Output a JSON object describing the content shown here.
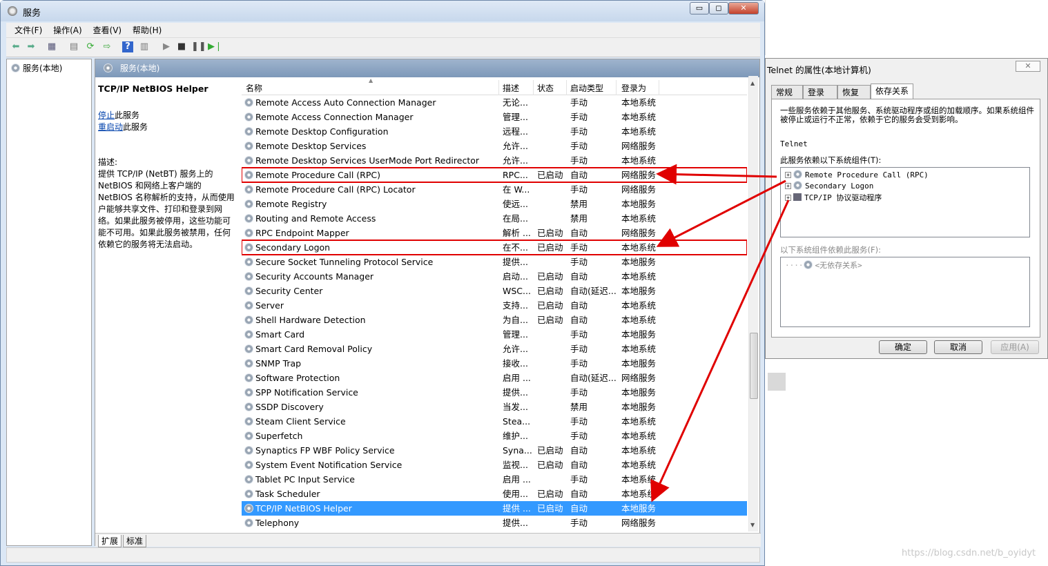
{
  "window": {
    "title": "服务",
    "buttons": {
      "minimize": "▭",
      "maximize": "◻",
      "close": "✕"
    }
  },
  "menu": [
    "文件(F)",
    "操作(A)",
    "查看(V)",
    "帮助(H)"
  ],
  "left_tree": {
    "root": "服务(本地)"
  },
  "panel_header": "服务(本地)",
  "detail": {
    "title": "TCP/IP NetBIOS Helper",
    "stop_link": "停止",
    "stop_suffix": "此服务",
    "restart_link": "重启动",
    "restart_suffix": "此服务",
    "desc_label": "描述:",
    "desc_text": "提供 TCP/IP (NetBT) 服务上的 NetBIOS 和网络上客户端的 NetBIOS 名称解析的支持，从而使用户能够共享文件、打印和登录到网络。如果此服务被停用，这些功能可能不可用。如果此服务被禁用，任何依赖它的服务将无法启动。"
  },
  "columns": {
    "name": "名称",
    "desc": "描述",
    "status": "状态",
    "startup": "启动类型",
    "logon": "登录为"
  },
  "rows": [
    {
      "name": "Remote Access Auto Connection Manager",
      "desc": "无论...",
      "status": "",
      "startup": "手动",
      "logon": "本地系统"
    },
    {
      "name": "Remote Access Connection Manager",
      "desc": "管理...",
      "status": "",
      "startup": "手动",
      "logon": "本地系统"
    },
    {
      "name": "Remote Desktop Configuration",
      "desc": "远程...",
      "status": "",
      "startup": "手动",
      "logon": "本地系统"
    },
    {
      "name": "Remote Desktop Services",
      "desc": "允许...",
      "status": "",
      "startup": "手动",
      "logon": "网络服务"
    },
    {
      "name": "Remote Desktop Services UserMode Port Redirector",
      "desc": "允许...",
      "status": "",
      "startup": "手动",
      "logon": "本地系统"
    },
    {
      "name": "Remote Procedure Call (RPC)",
      "desc": "RPC...",
      "status": "已启动",
      "startup": "自动",
      "logon": "网络服务"
    },
    {
      "name": "Remote Procedure Call (RPC) Locator",
      "desc": "在 W...",
      "status": "",
      "startup": "手动",
      "logon": "网络服务"
    },
    {
      "name": "Remote Registry",
      "desc": "使远...",
      "status": "",
      "startup": "禁用",
      "logon": "本地服务"
    },
    {
      "name": "Routing and Remote Access",
      "desc": "在局...",
      "status": "",
      "startup": "禁用",
      "logon": "本地系统"
    },
    {
      "name": "RPC Endpoint Mapper",
      "desc": "解析 ...",
      "status": "已启动",
      "startup": "自动",
      "logon": "网络服务"
    },
    {
      "name": "Secondary Logon",
      "desc": "在不...",
      "status": "已启动",
      "startup": "手动",
      "logon": "本地系统"
    },
    {
      "name": "Secure Socket Tunneling Protocol Service",
      "desc": "提供...",
      "status": "",
      "startup": "手动",
      "logon": "本地服务"
    },
    {
      "name": "Security Accounts Manager",
      "desc": "启动...",
      "status": "已启动",
      "startup": "自动",
      "logon": "本地系统"
    },
    {
      "name": "Security Center",
      "desc": "WSC...",
      "status": "已启动",
      "startup": "自动(延迟...",
      "logon": "本地服务"
    },
    {
      "name": "Server",
      "desc": "支持...",
      "status": "已启动",
      "startup": "自动",
      "logon": "本地系统"
    },
    {
      "name": "Shell Hardware Detection",
      "desc": "为自...",
      "status": "已启动",
      "startup": "自动",
      "logon": "本地系统"
    },
    {
      "name": "Smart Card",
      "desc": "管理...",
      "status": "",
      "startup": "手动",
      "logon": "本地服务"
    },
    {
      "name": "Smart Card Removal Policy",
      "desc": "允许...",
      "status": "",
      "startup": "手动",
      "logon": "本地系统"
    },
    {
      "name": "SNMP Trap",
      "desc": "接收...",
      "status": "",
      "startup": "手动",
      "logon": "本地服务"
    },
    {
      "name": "Software Protection",
      "desc": "启用 ...",
      "status": "",
      "startup": "自动(延迟...",
      "logon": "网络服务"
    },
    {
      "name": "SPP Notification Service",
      "desc": "提供...",
      "status": "",
      "startup": "手动",
      "logon": "本地服务"
    },
    {
      "name": "SSDP Discovery",
      "desc": "当发...",
      "status": "",
      "startup": "禁用",
      "logon": "本地服务"
    },
    {
      "name": "Steam Client Service",
      "desc": "Stea...",
      "status": "",
      "startup": "手动",
      "logon": "本地系统"
    },
    {
      "name": "Superfetch",
      "desc": "维护...",
      "status": "",
      "startup": "手动",
      "logon": "本地系统"
    },
    {
      "name": "Synaptics FP WBF Policy Service",
      "desc": "Syna...",
      "status": "已启动",
      "startup": "自动",
      "logon": "本地系统"
    },
    {
      "name": "System Event Notification Service",
      "desc": "监视...",
      "status": "已启动",
      "startup": "自动",
      "logon": "本地系统"
    },
    {
      "name": "Tablet PC Input Service",
      "desc": "启用 ...",
      "status": "",
      "startup": "手动",
      "logon": "本地系统"
    },
    {
      "name": "Task Scheduler",
      "desc": "使用...",
      "status": "已启动",
      "startup": "自动",
      "logon": "本地系统"
    },
    {
      "name": "TCP/IP NetBIOS Helper",
      "desc": "提供 ...",
      "status": "已启动",
      "startup": "自动",
      "logon": "本地服务"
    },
    {
      "name": "Telephony",
      "desc": "提供...",
      "status": "",
      "startup": "手动",
      "logon": "网络服务"
    }
  ],
  "selected_row": "TCP/IP NetBIOS Helper",
  "highlighted_rows": [
    "Remote Procedure Call (RPC)",
    "Secondary Logon"
  ],
  "bottom_tabs": [
    "扩展",
    "标准"
  ],
  "dialog": {
    "title": "Telnet 的属性(本地计算机)",
    "close": "✕",
    "tabs": [
      "常规",
      "登录",
      "恢复",
      "依存关系"
    ],
    "active_tab": "依存关系",
    "intro": "一些服务依赖于其他服务、系统驱动程序或组的加载顺序。如果系统组件被停止或运行不正常，依赖于它的服务会受到影响。",
    "service_name": "Telnet",
    "depends_label": "此服务依赖以下系统组件(T):",
    "depends_on": [
      "Remote Procedure Call (RPC)",
      "Secondary Logon",
      "TCP/IP 协议驱动程序"
    ],
    "dependents_label": "以下系统组件依赖此服务(F):",
    "dependents": [
      "<无依存关系>"
    ],
    "buttons": {
      "ok": "确定",
      "cancel": "取消",
      "apply": "应用(A)"
    }
  },
  "watermark": "https://blog.csdn.net/b_oyidyt",
  "colors": {
    "annotation": "#e00000",
    "selection": "#3399ff"
  }
}
